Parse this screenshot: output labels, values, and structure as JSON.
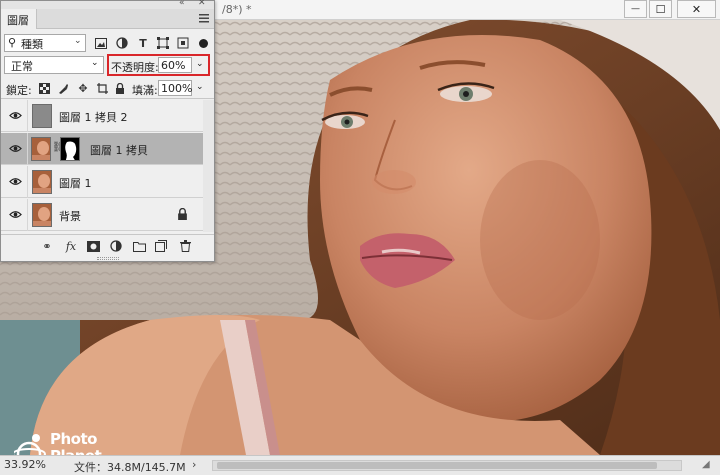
{
  "document": {
    "title_fragment": "/8*) *",
    "zoom": "33.92%",
    "info": "文件：34.8M/145.7M",
    "info_arrow": "›"
  },
  "window_controls": {
    "minimize_glyph": "—",
    "maximize_glyph": "☐",
    "close_glyph": "✕"
  },
  "layers_panel": {
    "tab_label": "圖層",
    "filter_kind": "種類",
    "filter_icons": [
      "image-filter-icon",
      "adjustment-filter-icon",
      "type-filter-icon",
      "shape-filter-icon",
      "smart-object-filter-icon"
    ],
    "blend_mode": "正常",
    "opacity_label": "不透明度:",
    "opacity_value": "60%",
    "lock_label": "鎖定:",
    "fill_label": "填滿:",
    "fill_value": "100%",
    "layers": [
      {
        "name": "圖層 1 拷貝 2",
        "visible": true,
        "selected": false,
        "thumb": "gray"
      },
      {
        "name": "圖層 1 拷貝",
        "visible": true,
        "selected": true,
        "thumb": "photo",
        "has_mask": true
      },
      {
        "name": "圖層 1",
        "visible": true,
        "selected": false,
        "thumb": "photo"
      },
      {
        "name": "背景",
        "visible": true,
        "selected": false,
        "thumb": "photo",
        "locked": true
      }
    ],
    "footer_fx_label": "fx"
  },
  "watermark": {
    "line1": "Photo",
    "line2": "Planet"
  },
  "colors": {
    "selection_highlight": "#d9262a",
    "selected_layer_bg": "#b3b3b3",
    "panel_bg": "#efefef"
  }
}
